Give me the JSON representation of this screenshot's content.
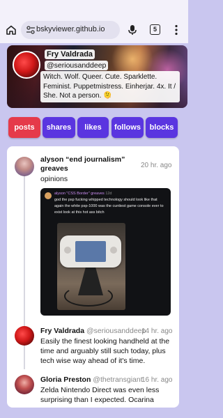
{
  "browser": {
    "url": "bskyviewer.github.io",
    "tab_count": "5"
  },
  "profile": {
    "name": "Fry Valdrada",
    "handle": "@seriousanddeep",
    "bio": "Witch. Wolf. Queer. Cute. Sparklette. Feminist. Puppetmistress. Einherjar. 4x. It / She. Not a person. 🫠"
  },
  "tabs": [
    {
      "label": "posts",
      "active": true
    },
    {
      "label": "shares",
      "active": false
    },
    {
      "label": "likes",
      "active": false
    },
    {
      "label": "follows",
      "active": false
    },
    {
      "label": "blocks",
      "active": false
    }
  ],
  "colors": {
    "active_tab": "#e53a4a",
    "inactive_tab": "#5a35e0",
    "page_bg": "#c9c6ef"
  },
  "feed": {
    "posts": [
      {
        "name": "alyson “end journalism” greaves",
        "handle": "",
        "time": "20 hr. ago",
        "text": "opinions",
        "embed": {
          "author": "alyson \"CSS Border\" greaves",
          "time": "12d",
          "text": "god the psp fucking whipped technology should look like that again the white psp-1000 was the cuntiest game console ever to exist look at this hot ass bitch"
        }
      },
      {
        "name": "Fry Valdrada",
        "handle": "@seriousanddeep",
        "time": "14 hr. ago",
        "text": "Easily the finest looking handheld at the time and arguably still such today, plus tech wise way ahead of it's time."
      },
      {
        "name": "Gloria Preston",
        "handle": "@thetransgiant",
        "time": "16 hr. ago",
        "text": "Zelda Nintendo Direct was even less surprising than I expected. Ocarina"
      }
    ]
  }
}
